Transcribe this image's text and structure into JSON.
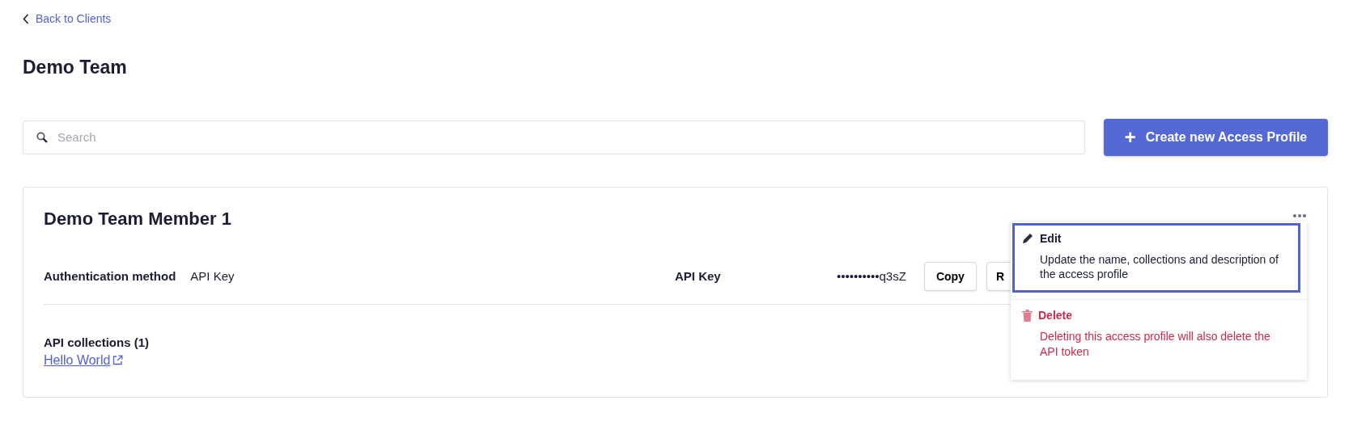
{
  "back_link": {
    "label": "Back to Clients"
  },
  "page_title": "Demo Team",
  "search": {
    "placeholder": "Search"
  },
  "create_button": {
    "icon": "+",
    "label": "Create new Access Profile"
  },
  "profile": {
    "title": "Demo Team Member 1",
    "fields": [
      {
        "label": "Authentication method",
        "value": "API Key"
      }
    ],
    "api_key": {
      "label": "API Key",
      "value": "••••••••••q3sZ",
      "buttons": [
        "Copy",
        "R"
      ]
    },
    "collections": {
      "heading": "API collections (1)",
      "links": [
        "Hello World"
      ]
    },
    "menu": {
      "open": true,
      "items": [
        {
          "kind": "edit",
          "label": "Edit",
          "description": "Update the name, collections and description of the access profile",
          "selected": true
        },
        {
          "kind": "delete",
          "label": "Delete",
          "description": "Deleting this access profile will also delete the API token",
          "selected": false
        }
      ]
    }
  }
}
